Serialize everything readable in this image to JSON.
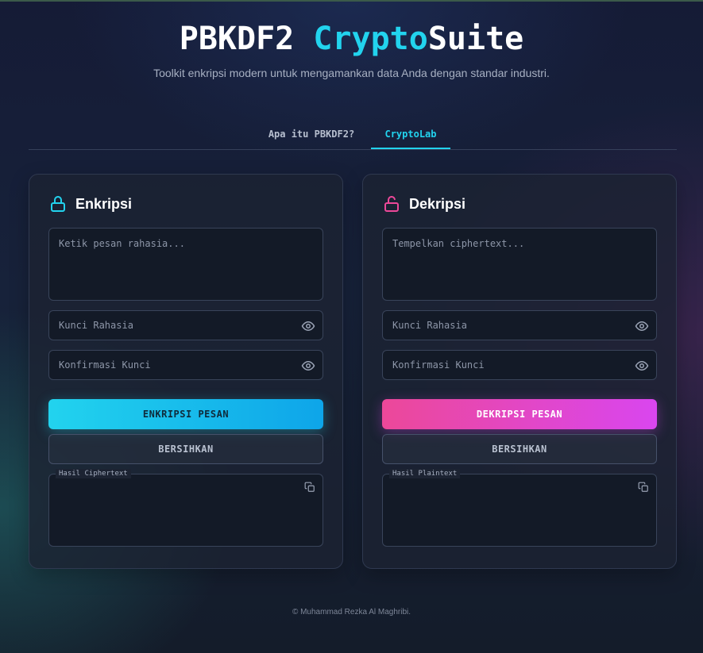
{
  "header": {
    "title_part1": "PBKDF2 ",
    "title_accent": "Crypto",
    "title_part2": "Suite",
    "subtitle": "Toolkit enkripsi modern untuk mengamankan data Anda dengan standar industri."
  },
  "tabs": [
    {
      "label": "Apa itu PBKDF2?",
      "active": false
    },
    {
      "label": "CryptoLab",
      "active": true
    }
  ],
  "encrypt": {
    "title": "Enkripsi",
    "message_placeholder": "Ketik pesan rahasia...",
    "key_placeholder": "Kunci Rahasia",
    "confirm_placeholder": "Konfirmasi Kunci",
    "primary_button": "ENKRIPSI PESAN",
    "clear_button": "BERSIHKAN",
    "output_label": "Hasil Ciphertext",
    "accent_color": "#22d3ee"
  },
  "decrypt": {
    "title": "Dekripsi",
    "message_placeholder": "Tempelkan ciphertext...",
    "key_placeholder": "Kunci Rahasia",
    "confirm_placeholder": "Konfirmasi Kunci",
    "primary_button": "DEKRIPSI PESAN",
    "clear_button": "BERSIHKAN",
    "output_label": "Hasil Plaintext",
    "accent_color": "#ec4899"
  },
  "icons": {
    "encrypt": "lock-closed-icon",
    "decrypt": "lock-open-icon",
    "eye": "eye-icon",
    "copy": "copy-icon"
  },
  "footer": {
    "text": "© Muhammad Rezka Al Maghribi."
  }
}
